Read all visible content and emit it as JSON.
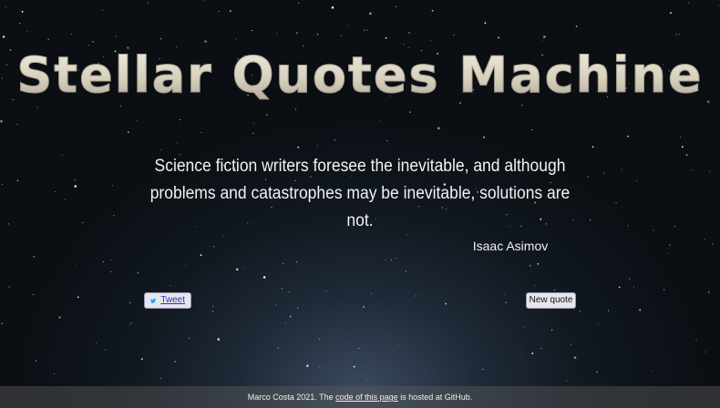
{
  "app": {
    "title": "Stellar Quotes Machine"
  },
  "quote": {
    "text": "Science fiction writers foresee the inevitable, and although problems and catastrophes may be inevitable, solutions are not.",
    "author": "Isaac Asimov"
  },
  "buttons": {
    "tweet_label": "Tweet",
    "tweet_icon": "twitter-bird-icon",
    "new_quote_label": "New quote"
  },
  "footer": {
    "prefix": "Marco Costa 2021. The ",
    "link_text": "code of this page",
    "suffix": " is hosted at GitHub."
  },
  "colors": {
    "background": "#0b0f14",
    "twitter_blue": "#1da1f2",
    "link": "#3a2bb8"
  }
}
